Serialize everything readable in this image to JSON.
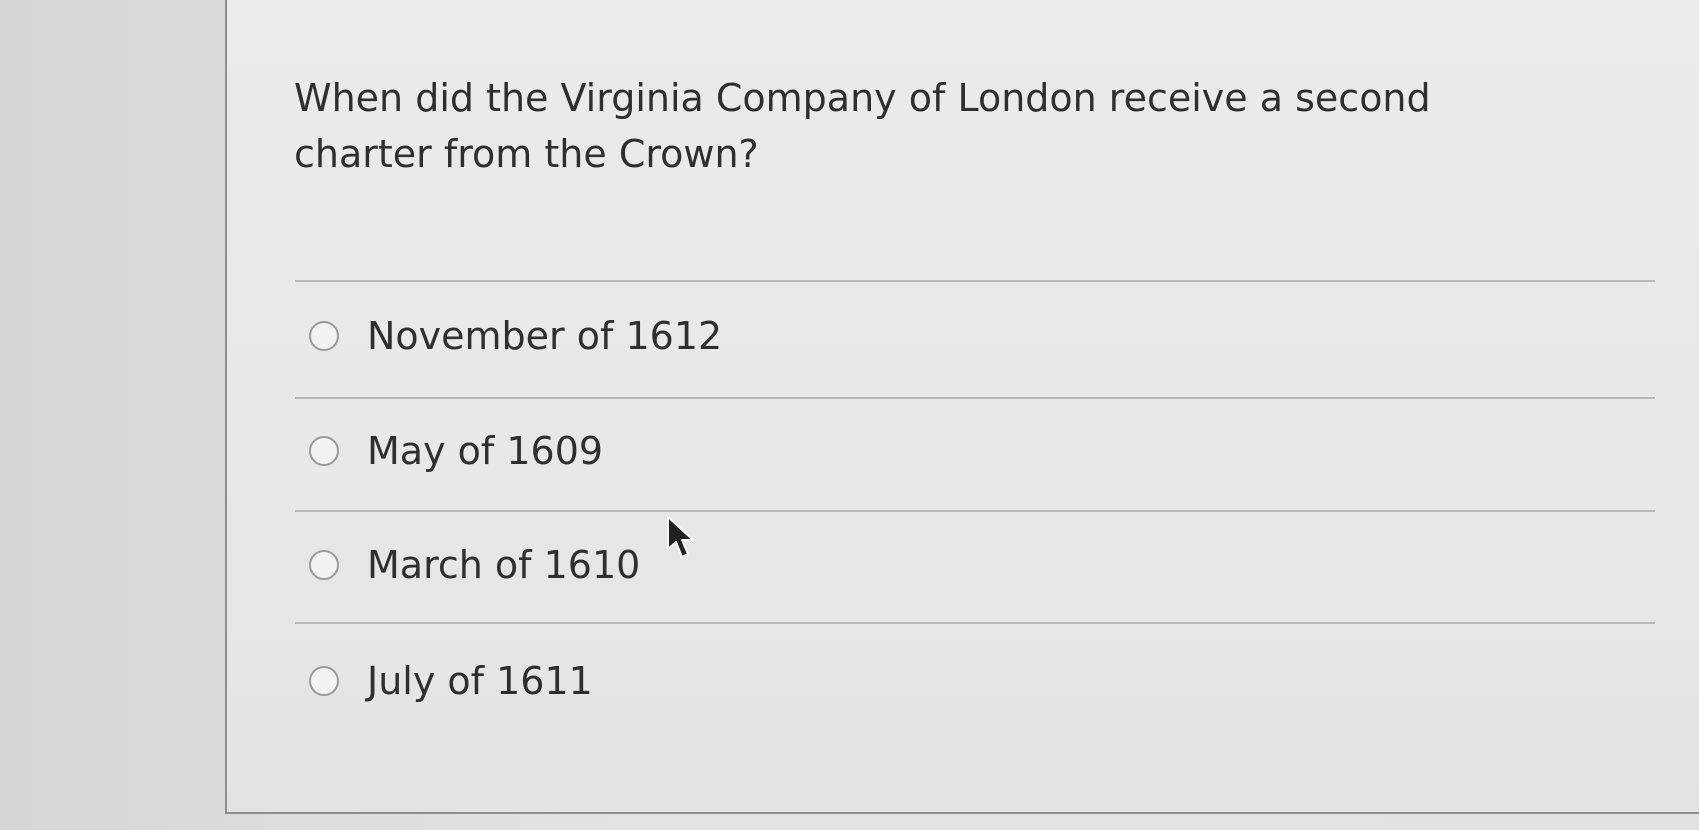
{
  "question": {
    "text": "When did the Virginia Company of London receive a second charter from the Crown?"
  },
  "answers": [
    {
      "label": "November of 1612"
    },
    {
      "label": "May of 1609"
    },
    {
      "label": "March of 1610"
    },
    {
      "label": "July of 1611"
    }
  ],
  "colors": {
    "text": "#2f2f2f",
    "card_border": "#8d8d8b",
    "divider": "#b9b9b7",
    "radio_border": "#9a9a98"
  },
  "icons": {
    "cursor": "mouse-pointer-icon",
    "radio": "radio-unselected-icon"
  }
}
